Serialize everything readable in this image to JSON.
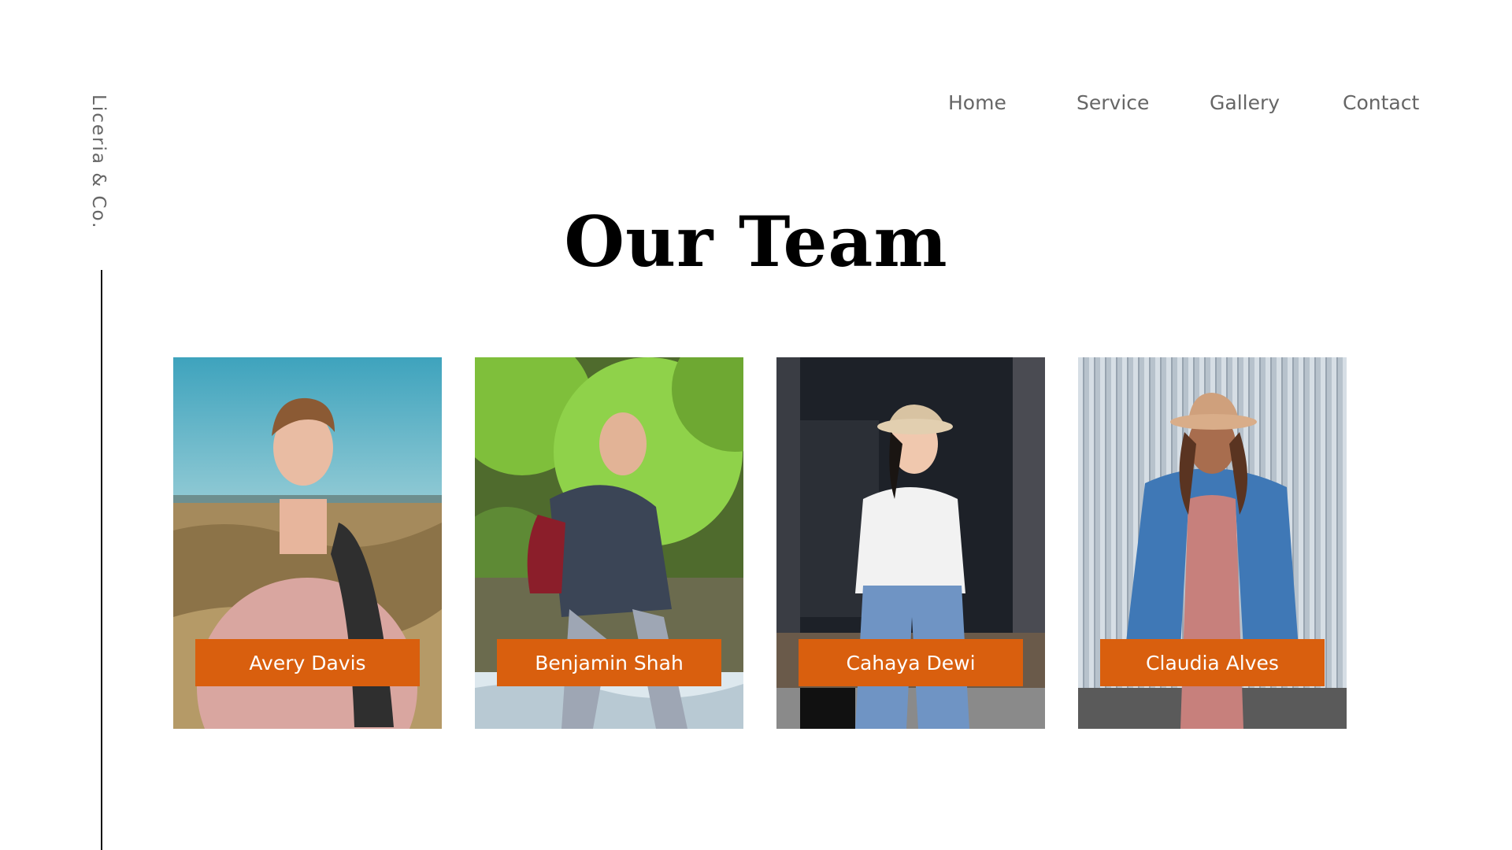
{
  "brand": "Liceria & Co.",
  "nav": {
    "items": [
      "Home",
      "Service",
      "Gallery",
      "Contact"
    ]
  },
  "title": "Our Team",
  "accent_color": "#d95f0e",
  "team": [
    {
      "name": "Avery Davis"
    },
    {
      "name": "Benjamin Shah"
    },
    {
      "name": "Cahaya Dewi"
    },
    {
      "name": "Claudia Alves"
    }
  ]
}
